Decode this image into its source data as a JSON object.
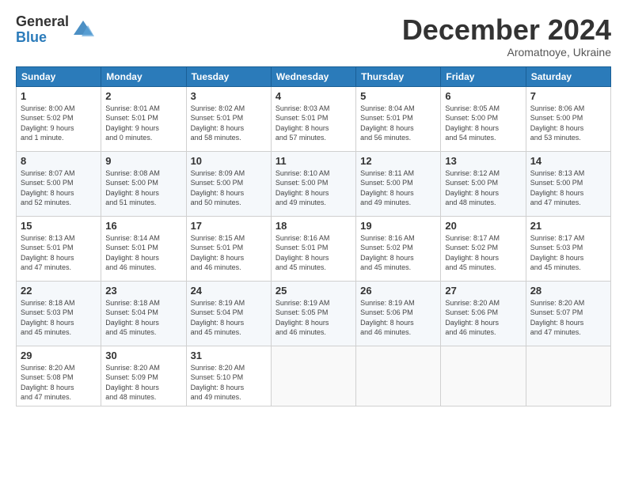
{
  "header": {
    "logo_general": "General",
    "logo_blue": "Blue",
    "month_title": "December 2024",
    "subtitle": "Aromatnoye, Ukraine"
  },
  "days_of_week": [
    "Sunday",
    "Monday",
    "Tuesday",
    "Wednesday",
    "Thursday",
    "Friday",
    "Saturday"
  ],
  "weeks": [
    [
      {
        "day": "1",
        "info": "Sunrise: 8:00 AM\nSunset: 5:02 PM\nDaylight: 9 hours\nand 1 minute."
      },
      {
        "day": "2",
        "info": "Sunrise: 8:01 AM\nSunset: 5:01 PM\nDaylight: 9 hours\nand 0 minutes."
      },
      {
        "day": "3",
        "info": "Sunrise: 8:02 AM\nSunset: 5:01 PM\nDaylight: 8 hours\nand 58 minutes."
      },
      {
        "day": "4",
        "info": "Sunrise: 8:03 AM\nSunset: 5:01 PM\nDaylight: 8 hours\nand 57 minutes."
      },
      {
        "day": "5",
        "info": "Sunrise: 8:04 AM\nSunset: 5:01 PM\nDaylight: 8 hours\nand 56 minutes."
      },
      {
        "day": "6",
        "info": "Sunrise: 8:05 AM\nSunset: 5:00 PM\nDaylight: 8 hours\nand 54 minutes."
      },
      {
        "day": "7",
        "info": "Sunrise: 8:06 AM\nSunset: 5:00 PM\nDaylight: 8 hours\nand 53 minutes."
      }
    ],
    [
      {
        "day": "8",
        "info": "Sunrise: 8:07 AM\nSunset: 5:00 PM\nDaylight: 8 hours\nand 52 minutes."
      },
      {
        "day": "9",
        "info": "Sunrise: 8:08 AM\nSunset: 5:00 PM\nDaylight: 8 hours\nand 51 minutes."
      },
      {
        "day": "10",
        "info": "Sunrise: 8:09 AM\nSunset: 5:00 PM\nDaylight: 8 hours\nand 50 minutes."
      },
      {
        "day": "11",
        "info": "Sunrise: 8:10 AM\nSunset: 5:00 PM\nDaylight: 8 hours\nand 49 minutes."
      },
      {
        "day": "12",
        "info": "Sunrise: 8:11 AM\nSunset: 5:00 PM\nDaylight: 8 hours\nand 49 minutes."
      },
      {
        "day": "13",
        "info": "Sunrise: 8:12 AM\nSunset: 5:00 PM\nDaylight: 8 hours\nand 48 minutes."
      },
      {
        "day": "14",
        "info": "Sunrise: 8:13 AM\nSunset: 5:00 PM\nDaylight: 8 hours\nand 47 minutes."
      }
    ],
    [
      {
        "day": "15",
        "info": "Sunrise: 8:13 AM\nSunset: 5:01 PM\nDaylight: 8 hours\nand 47 minutes."
      },
      {
        "day": "16",
        "info": "Sunrise: 8:14 AM\nSunset: 5:01 PM\nDaylight: 8 hours\nand 46 minutes."
      },
      {
        "day": "17",
        "info": "Sunrise: 8:15 AM\nSunset: 5:01 PM\nDaylight: 8 hours\nand 46 minutes."
      },
      {
        "day": "18",
        "info": "Sunrise: 8:16 AM\nSunset: 5:01 PM\nDaylight: 8 hours\nand 45 minutes."
      },
      {
        "day": "19",
        "info": "Sunrise: 8:16 AM\nSunset: 5:02 PM\nDaylight: 8 hours\nand 45 minutes."
      },
      {
        "day": "20",
        "info": "Sunrise: 8:17 AM\nSunset: 5:02 PM\nDaylight: 8 hours\nand 45 minutes."
      },
      {
        "day": "21",
        "info": "Sunrise: 8:17 AM\nSunset: 5:03 PM\nDaylight: 8 hours\nand 45 minutes."
      }
    ],
    [
      {
        "day": "22",
        "info": "Sunrise: 8:18 AM\nSunset: 5:03 PM\nDaylight: 8 hours\nand 45 minutes."
      },
      {
        "day": "23",
        "info": "Sunrise: 8:18 AM\nSunset: 5:04 PM\nDaylight: 8 hours\nand 45 minutes."
      },
      {
        "day": "24",
        "info": "Sunrise: 8:19 AM\nSunset: 5:04 PM\nDaylight: 8 hours\nand 45 minutes."
      },
      {
        "day": "25",
        "info": "Sunrise: 8:19 AM\nSunset: 5:05 PM\nDaylight: 8 hours\nand 46 minutes."
      },
      {
        "day": "26",
        "info": "Sunrise: 8:19 AM\nSunset: 5:06 PM\nDaylight: 8 hours\nand 46 minutes."
      },
      {
        "day": "27",
        "info": "Sunrise: 8:20 AM\nSunset: 5:06 PM\nDaylight: 8 hours\nand 46 minutes."
      },
      {
        "day": "28",
        "info": "Sunrise: 8:20 AM\nSunset: 5:07 PM\nDaylight: 8 hours\nand 47 minutes."
      }
    ],
    [
      {
        "day": "29",
        "info": "Sunrise: 8:20 AM\nSunset: 5:08 PM\nDaylight: 8 hours\nand 47 minutes."
      },
      {
        "day": "30",
        "info": "Sunrise: 8:20 AM\nSunset: 5:09 PM\nDaylight: 8 hours\nand 48 minutes."
      },
      {
        "day": "31",
        "info": "Sunrise: 8:20 AM\nSunset: 5:10 PM\nDaylight: 8 hours\nand 49 minutes."
      },
      {
        "day": "",
        "info": ""
      },
      {
        "day": "",
        "info": ""
      },
      {
        "day": "",
        "info": ""
      },
      {
        "day": "",
        "info": ""
      }
    ]
  ]
}
